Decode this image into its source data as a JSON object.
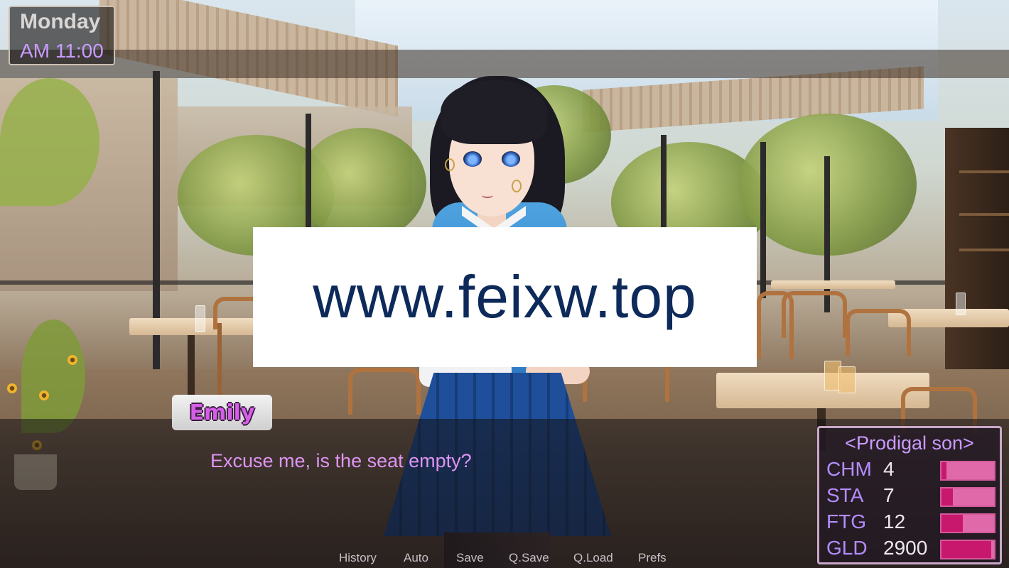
{
  "hud": {
    "day": "Monday",
    "time": "AM 11:00"
  },
  "watermark": {
    "text": "www.feixw.top"
  },
  "dialogue": {
    "speaker": "Emily",
    "text": "Excuse me, is the seat empty?"
  },
  "quick_menu": [
    {
      "label": "History"
    },
    {
      "label": "Auto"
    },
    {
      "label": "Save"
    },
    {
      "label": "Q.Save"
    },
    {
      "label": "Q.Load"
    },
    {
      "label": "Prefs"
    }
  ],
  "stats": {
    "title": "<Prodigal son>",
    "rows": [
      {
        "label": "CHM",
        "value": "4",
        "fill": 0.1
      },
      {
        "label": "STA",
        "value": "7",
        "fill": 0.22
      },
      {
        "label": "FTG",
        "value": "12",
        "fill": 0.4
      },
      {
        "label": "GLD",
        "value": "2900",
        "fill": 0.95
      }
    ]
  },
  "colors": {
    "speaker_name": "#d45fe6",
    "dialogue_text": "#de94f2",
    "clock_text": "#c99bff",
    "stat_bar_bg": "#e069aa",
    "stat_bar_fill": "#c8186d"
  }
}
